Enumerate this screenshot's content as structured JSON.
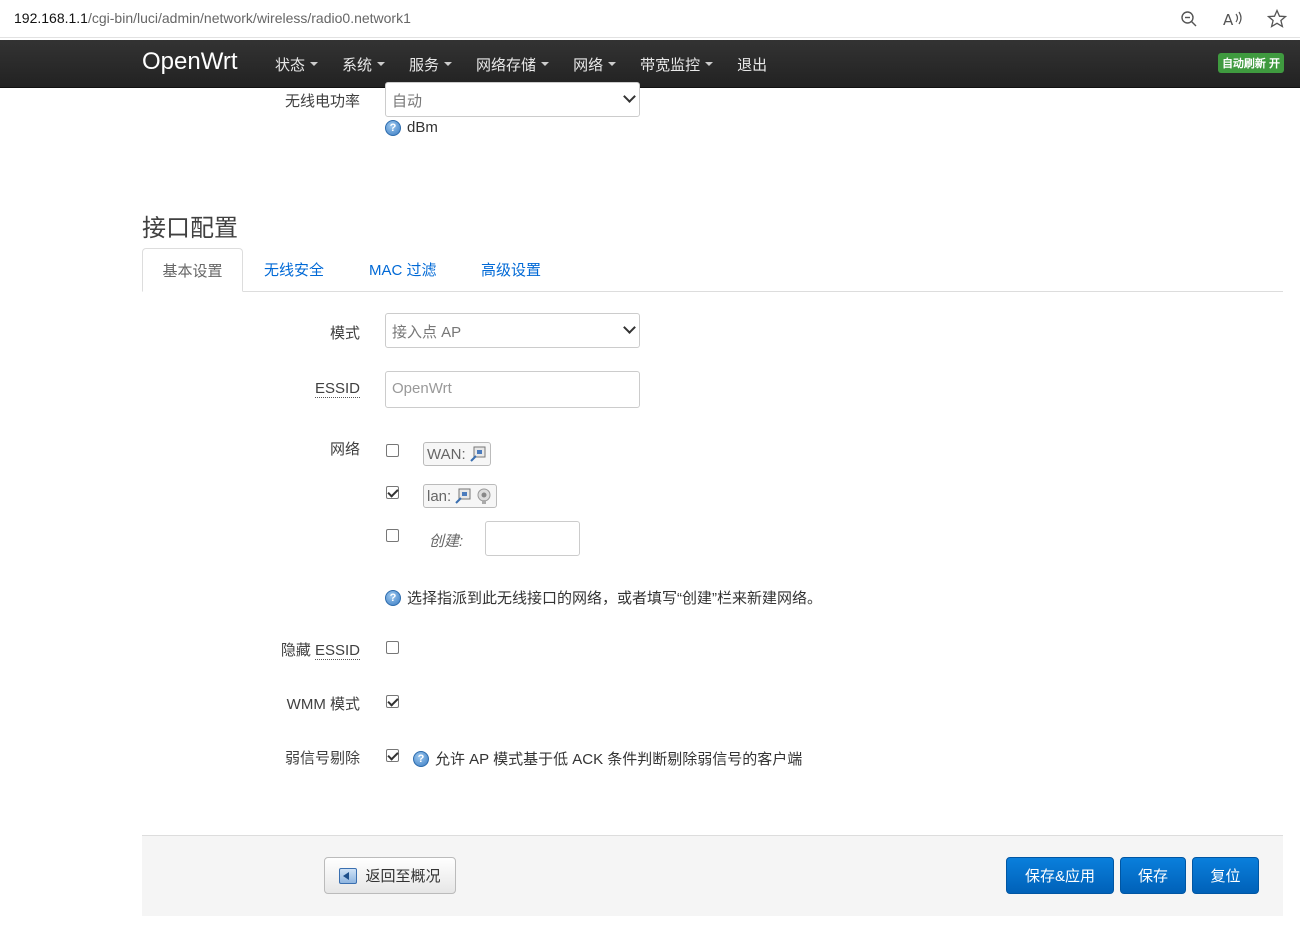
{
  "browser": {
    "url_host": "192.168.1.1",
    "url_path": "/cgi-bin/luci/admin/network/wireless/radio0.network1"
  },
  "navbar": {
    "brand": "OpenWrt",
    "menu": [
      {
        "label": "状态",
        "has_caret": true
      },
      {
        "label": "系统",
        "has_caret": true
      },
      {
        "label": "服务",
        "has_caret": true
      },
      {
        "label": "网络存储",
        "has_caret": true
      },
      {
        "label": "网络",
        "has_caret": true
      },
      {
        "label": "带宽监控",
        "has_caret": true
      },
      {
        "label": "退出",
        "has_caret": false
      }
    ],
    "auto_refresh": "自动刷新 开"
  },
  "tx_power": {
    "label": "无线电功率",
    "value": "自动",
    "unit_help": "dBm"
  },
  "interface_section": {
    "title": "接口配置",
    "tabs": [
      {
        "label": "基本设置",
        "active": true
      },
      {
        "label": "无线安全",
        "active": false
      },
      {
        "label": "MAC 过滤",
        "active": false
      },
      {
        "label": "高级设置",
        "active": false
      }
    ]
  },
  "form": {
    "mode": {
      "label": "模式",
      "value": "接入点 AP"
    },
    "essid": {
      "label": "ESSID",
      "value": "OpenWrt"
    },
    "network": {
      "label": "网络",
      "options": [
        {
          "name": "WAN:",
          "checked": false
        },
        {
          "name": "lan:",
          "checked": true
        }
      ],
      "create_label": "创建:",
      "create_checked": false,
      "create_value": "",
      "help": "选择指派到此无线接口的网络，或者填写“创建”栏来新建网络。"
    },
    "hide_essid": {
      "label_prefix": "隐藏 ",
      "label_abbr": "ESSID",
      "checked": false
    },
    "wmm_mode": {
      "label": "WMM 模式",
      "checked": true
    },
    "weak_signal": {
      "label": "弱信号剔除",
      "checked": true,
      "help": "允许 AP 模式基于低 ACK 条件判断剔除弱信号的客户端"
    }
  },
  "actions": {
    "back": "返回至概况",
    "save_apply": "保存&应用",
    "save": "保存",
    "reset": "复位"
  },
  "colors": {
    "navbar": "#222222",
    "link": "#0069d6",
    "primary_button": "#0069d6",
    "badge": "#3f9a3f"
  }
}
